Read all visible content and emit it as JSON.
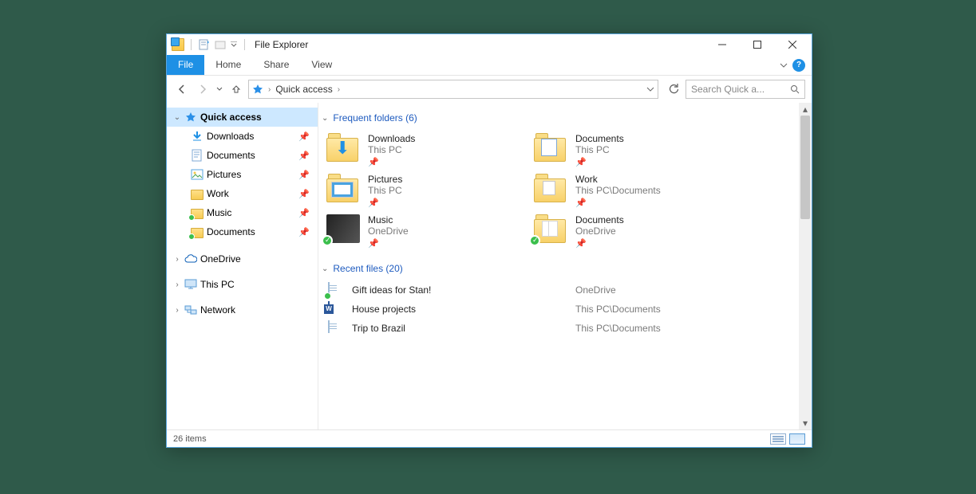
{
  "window": {
    "title": "File Explorer"
  },
  "ribbon": {
    "file": "File",
    "tabs": [
      "Home",
      "Share",
      "View"
    ]
  },
  "nav": {
    "breadcrumb_label": "Quick access",
    "search_placeholder": "Search Quick a..."
  },
  "sidebar": {
    "quick_access": "Quick access",
    "items": [
      {
        "label": "Downloads",
        "icon": "download",
        "pinned": true
      },
      {
        "label": "Documents",
        "icon": "document",
        "pinned": true
      },
      {
        "label": "Pictures",
        "icon": "pictures",
        "pinned": true
      },
      {
        "label": "Work",
        "icon": "folder",
        "pinned": true
      },
      {
        "label": "Music",
        "icon": "folder",
        "pinned": true
      },
      {
        "label": "Documents",
        "icon": "folder",
        "pinned": true
      }
    ],
    "onedrive": "OneDrive",
    "this_pc": "This PC",
    "network": "Network"
  },
  "groups": {
    "frequent": {
      "title": "Frequent folders (6)"
    },
    "recent": {
      "title": "Recent files (20)"
    }
  },
  "folders": [
    {
      "name": "Downloads",
      "location": "This PC",
      "overlay": "download",
      "sync": false
    },
    {
      "name": "Documents",
      "location": "This PC",
      "overlay": "doc",
      "sync": false
    },
    {
      "name": "Pictures",
      "location": "This PC",
      "overlay": "picture",
      "sync": false
    },
    {
      "name": "Work",
      "location": "This PC\\Documents",
      "overlay": "none",
      "sync": false
    },
    {
      "name": "Music",
      "location": "OneDrive",
      "overlay": "music",
      "sync": true
    },
    {
      "name": "Documents",
      "location": "OneDrive",
      "overlay": "none",
      "sync": true
    }
  ],
  "recent_files": [
    {
      "name": "Gift ideas for Stan!",
      "location": "OneDrive",
      "icon": "doc"
    },
    {
      "name": "House projects",
      "location": "This PC\\Documents",
      "icon": "word"
    },
    {
      "name": "Trip to Brazil",
      "location": "This PC\\Documents",
      "icon": "doc"
    }
  ],
  "status": {
    "item_count": "26 items"
  }
}
